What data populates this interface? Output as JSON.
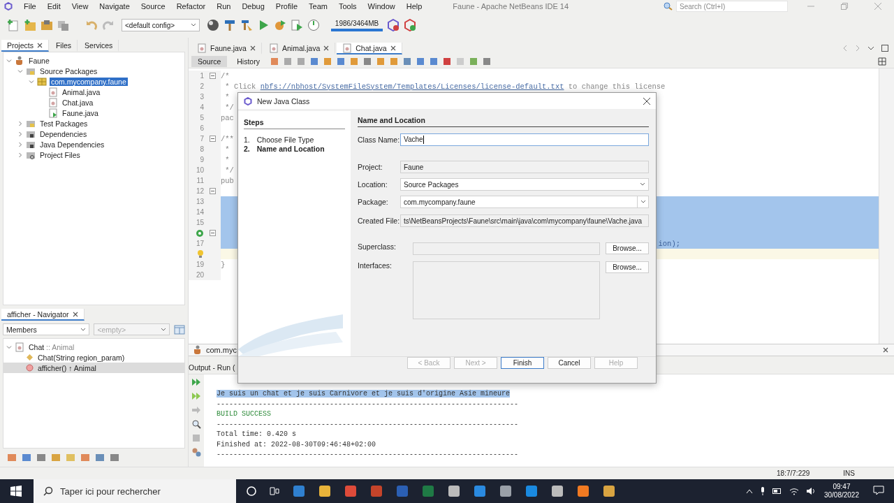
{
  "window": {
    "title": "Faune - Apache NetBeans IDE 14"
  },
  "menu": [
    "File",
    "Edit",
    "View",
    "Navigate",
    "Source",
    "Refactor",
    "Run",
    "Debug",
    "Profile",
    "Team",
    "Tools",
    "Window",
    "Help"
  ],
  "search": {
    "placeholder": "Search (Ctrl+I)"
  },
  "toolbar": {
    "config": "<default config>",
    "memory": "1986/3464MB"
  },
  "project_tabs": [
    {
      "label": "Projects",
      "selected": true
    },
    {
      "label": "Files",
      "selected": false
    },
    {
      "label": "Services",
      "selected": false
    }
  ],
  "project_tree": [
    {
      "label": "Faune",
      "kind": "project",
      "expanded": true,
      "selected": false,
      "children": [
        {
          "label": "Source Packages",
          "kind": "sources",
          "expanded": true,
          "selected": false,
          "children": [
            {
              "label": "com.mycompany.faune",
              "kind": "package",
              "expanded": true,
              "selected": true,
              "children": [
                {
                  "label": "Animal.java",
                  "kind": "class",
                  "selected": false
                },
                {
                  "label": "Chat.java",
                  "kind": "class",
                  "selected": false
                },
                {
                  "label": "Faune.java",
                  "kind": "main",
                  "selected": false
                }
              ]
            }
          ]
        },
        {
          "label": "Test Packages",
          "kind": "sources",
          "expanded": false,
          "selected": false
        },
        {
          "label": "Dependencies",
          "kind": "library",
          "expanded": false,
          "selected": false
        },
        {
          "label": "Java Dependencies",
          "kind": "library",
          "expanded": false,
          "selected": false
        },
        {
          "label": "Project Files",
          "kind": "config",
          "expanded": false,
          "selected": false
        }
      ]
    }
  ],
  "navigator": {
    "title": "afficher - Navigator",
    "filter": "Members",
    "filter_2": {
      "value": "<empty>",
      "disabled": true
    },
    "tree": [
      {
        "label": "Chat",
        "suffix": ":: Animal",
        "kind": "class",
        "expanded": true,
        "selected": false,
        "children": [
          {
            "label": "Chat(String region_param)",
            "kind": "constructor",
            "selected": false
          },
          {
            "label": "afficher() ↑ Animal",
            "kind": "method",
            "selected": true
          }
        ]
      }
    ]
  },
  "editor_tabs": [
    {
      "label": "Faune.java",
      "selected": false
    },
    {
      "label": "Animal.java",
      "selected": false
    },
    {
      "label": "Chat.java",
      "selected": true
    }
  ],
  "editor_views": [
    {
      "label": "Source",
      "selected": true
    },
    {
      "label": "History",
      "selected": false
    }
  ],
  "code_lines": [
    {
      "number": "1",
      "text": "/*",
      "fold": true,
      "selected": false,
      "current": false
    },
    {
      "number": "2",
      "text": " * Click ",
      "link": "nbfs://nbhost/SystemFileSystem/Templates/Licenses/license-default.txt",
      "after": " to change this license",
      "fold": false,
      "selected": false,
      "current": false
    },
    {
      "number": "3",
      "text": " *",
      "fold": false,
      "selected": false,
      "current": false
    },
    {
      "number": "4",
      "text": " */",
      "fold": false,
      "selected": false,
      "current": false
    },
    {
      "number": "5",
      "text": "pac",
      "fold": false,
      "selected": false,
      "current": false
    },
    {
      "number": "6",
      "fold": false,
      "selected": false,
      "current": false
    },
    {
      "number": "7",
      "text": "/**",
      "fold": true,
      "selected": false,
      "current": false
    },
    {
      "number": "8",
      "text": " *",
      "fold": false,
      "selected": false,
      "current": false
    },
    {
      "number": "9",
      "text": " *",
      "fold": false,
      "selected": false,
      "current": false
    },
    {
      "number": "10",
      "text": " */",
      "fold": false,
      "selected": false,
      "current": false
    },
    {
      "number": "11",
      "text": "pub",
      "fold": false,
      "selected": false,
      "current": false
    },
    {
      "number": "12",
      "fold": true,
      "selected": false,
      "current": false
    },
    {
      "number": "13",
      "fold": false,
      "selected": true,
      "current": false
    },
    {
      "number": "14",
      "fold": false,
      "selected": true,
      "current": false
    },
    {
      "number": "15",
      "fold": false,
      "selected": true,
      "current": false
    },
    {
      "kind": "override",
      "fold": true,
      "selected": true,
      "current": false
    },
    {
      "number": "17",
      "tail": "ion);",
      "fold": false,
      "selected": true,
      "current": false
    },
    {
      "kind": "hint",
      "fold": false,
      "selected": false,
      "current": true
    },
    {
      "number": "19",
      "text": "}",
      "fold": false,
      "selected": false,
      "current": false
    },
    {
      "number": "20",
      "fold": false,
      "selected": false,
      "current": false
    }
  ],
  "breadcrumb": "com.myc",
  "output": {
    "title": "Output - Run (",
    "lines": [
      {
        "kind": "text",
        "text": "Je suis un chat et je suis Carnivore et je suis d'origine Asie mineure",
        "selected": true
      },
      {
        "kind": "text",
        "text": "------------------------------------------------------------------------",
        "selected": false
      },
      {
        "kind": "success",
        "text": "BUILD SUCCESS",
        "selected": false
      },
      {
        "kind": "text",
        "text": "------------------------------------------------------------------------",
        "selected": false
      },
      {
        "kind": "text",
        "text": "Total time:  0.420 s",
        "selected": false
      },
      {
        "kind": "text",
        "text": "Finished at: 2022-08-30T09:46:48+02:00",
        "selected": false
      },
      {
        "kind": "text",
        "text": "------------------------------------------------------------------------",
        "selected": false
      }
    ]
  },
  "status_bar": {
    "position": "18:7/7:229",
    "mode": "INS"
  },
  "dialog": {
    "title": "New Java Class",
    "steps_title": "Steps",
    "steps": [
      {
        "number": "1.",
        "label": "Choose File Type",
        "selected": false
      },
      {
        "number": "2.",
        "label": "Name and Location",
        "selected": true
      }
    ],
    "heading": "Name and Location",
    "fields": [
      {
        "label": "Class Name:",
        "value": "Vache",
        "kind": "text"
      },
      {
        "label": "Project:",
        "value": "Faune",
        "kind": "readonly"
      },
      {
        "label": "Location:",
        "value": "Source Packages",
        "kind": "dropdown"
      },
      {
        "label": "Package:",
        "value": "com.mycompany.faune",
        "kind": "combo"
      },
      {
        "label": "Created File:",
        "value": "ts\\NetBeansProjects\\Faune\\src\\main\\java\\com\\mycompany\\faune\\Vache.java",
        "kind": "readonly"
      }
    ],
    "superclass": {
      "label": "Superclass:",
      "button": "Browse..."
    },
    "interfaces": {
      "label": "Interfaces:",
      "button": "Browse..."
    },
    "buttons": [
      {
        "label": "< Back",
        "disabled": true
      },
      {
        "label": "Next >",
        "disabled": true
      },
      {
        "label": "Finish",
        "disabled": false
      },
      {
        "label": "Cancel",
        "disabled": false
      },
      {
        "label": "Help",
        "disabled": true
      }
    ]
  },
  "taskbar": {
    "search_placeholder": "Taper ici pour rechercher",
    "time": "09:47",
    "date": "30/08/2022"
  }
}
